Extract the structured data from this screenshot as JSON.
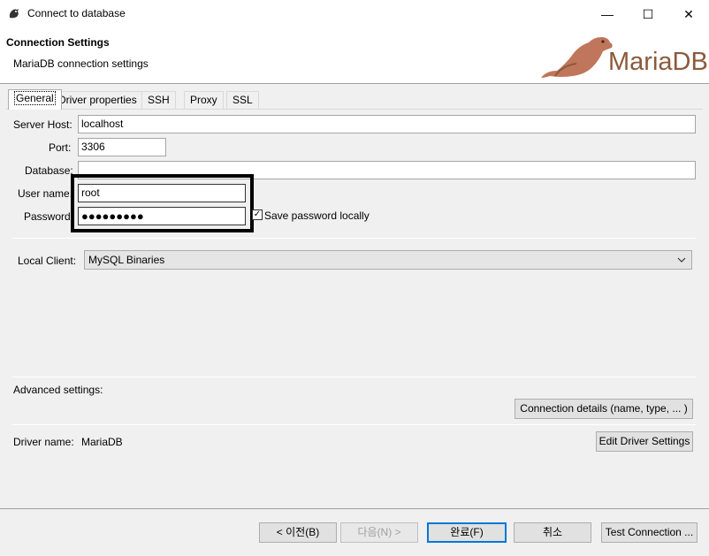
{
  "window": {
    "title": "Connect to database",
    "minimize": "—",
    "maximize": "☐",
    "close": "✕"
  },
  "header": {
    "title": "Connection Settings",
    "subtitle": "MariaDB connection settings",
    "logo_text": "MariaDB"
  },
  "tabs": [
    "General",
    "Driver properties",
    "SSH",
    "Proxy",
    "SSL"
  ],
  "form": {
    "server_host_label": "Server Host:",
    "server_host_value": "localhost",
    "port_label": "Port:",
    "port_value": "3306",
    "database_label": "Database:",
    "database_value": "",
    "username_label": "User name:",
    "username_value": "root",
    "password_label": "Password:",
    "password_value": "●●●●●●●●●",
    "save_password_label": "Save password locally",
    "save_password_checked": true,
    "local_client_label": "Local Client:",
    "local_client_value": "MySQL Binaries"
  },
  "advanced": {
    "label": "Advanced settings:",
    "connection_details_button": "Connection details (name, type, ... )"
  },
  "driver": {
    "label": "Driver name:",
    "value": "MariaDB",
    "edit_button": "Edit Driver Settings"
  },
  "footer": {
    "back_button": "< 이전(B)",
    "next_button": "다음(N) >",
    "finish_button": "완료(F)",
    "cancel_button": "취소",
    "test_button": "Test Connection ..."
  },
  "colors": {
    "accent": "#0078d7",
    "logo_brown": "#c0765a",
    "logo_text": "#8b5a3c"
  }
}
